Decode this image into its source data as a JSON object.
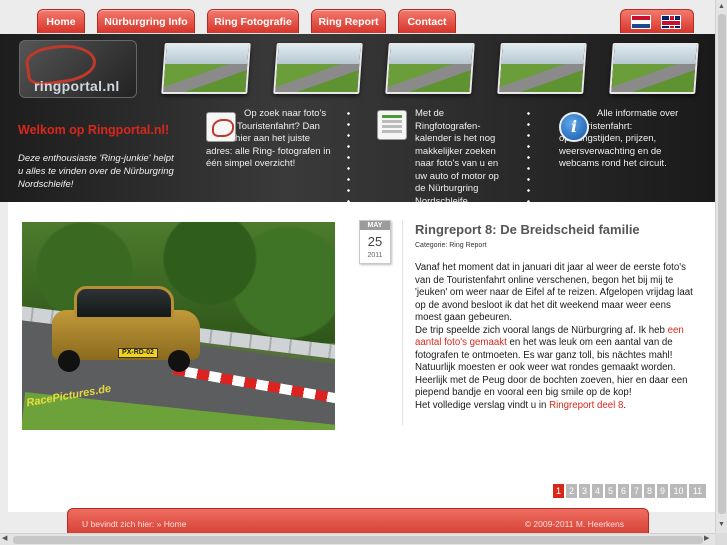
{
  "nav": {
    "items": [
      {
        "label": "Home"
      },
      {
        "label": "Nürburgring Info"
      },
      {
        "label": "Ring Fotografie"
      },
      {
        "label": "Ring Report"
      },
      {
        "label": "Contact"
      }
    ],
    "languages": [
      "nl-flag-icon",
      "uk-flag-icon"
    ]
  },
  "header": {
    "logo_text": "ringportal.nl",
    "welcome": "Welkom op Ringportal.nl!",
    "intro": "Deze enthousiaste 'Ring-junkie' helpt u alles te vinden over de Nürburgring Nordschleife!",
    "features": [
      {
        "icon": "track-map-icon",
        "text": "Op zoek naar foto's van de Touristenfahrt? Dan bent u hier aan het juiste adres: alle Ring- fotografen in één simpel overzicht!"
      },
      {
        "icon": "calendar-icon",
        "text": "Met de Ringfotografen- kalender is het nog makkelijker zoeken naar foto's van u en uw auto of motor op de Nürburgring Nordschleife."
      },
      {
        "icon": "info-icon",
        "text": "Alle informatie over de Touristenfahrt: openingstijden, prijzen, weersverwachting en de webcams rond het circuit."
      }
    ]
  },
  "post": {
    "date": {
      "month": "MAY",
      "day": "25",
      "year": "2011"
    },
    "title": "Ringreport 8: De Breidscheid familie",
    "category": "Categorie: Ring Report",
    "plate": "PX-RD-02",
    "watermark": "RacePictures.de",
    "p1": "Vanaf het moment dat in januari dit jaar al weer de eerste foto's van de Touristenfahrt online verschenen, begon het bij mij te 'jeuken' om weer naar de Eifel af te reizen. Afgelopen vrijdag laat op de avond besloot ik dat het dit weekend maar weer eens moest gaan gebeuren.",
    "p2_before": "De trip speelde zich vooral langs de Nürburgring af. Ik heb ",
    "p2_link": "een aantal foto's gemaakt",
    "p2_after": " en het was leuk om een aantal van de fotografen te ontmoeten. Es war ganz toll, bis nächtes mahl! Natuurlijk moesten er ook weer wat rondes gemaakt worden. Heerlijk met de Peug door de bochten zoeven, hier en daar een piepend bandje en vooral een big smile op de kop!",
    "p3_before": "Het volledige verslag vindt u in ",
    "p3_link": "Ringreport deel 8",
    "p3_after": "."
  },
  "pagination": {
    "pages": [
      "1",
      "2",
      "3",
      "4",
      "5",
      "6",
      "7",
      "8",
      "9",
      "10",
      "11"
    ],
    "active": "1"
  },
  "footer": {
    "breadcrumb": "U bevindt zich hier: » Home",
    "copyright": "© 2009-2011 M. Heerkens"
  },
  "colors": {
    "accent": "#d9281b",
    "header_bg": "#2a2a2a"
  }
}
